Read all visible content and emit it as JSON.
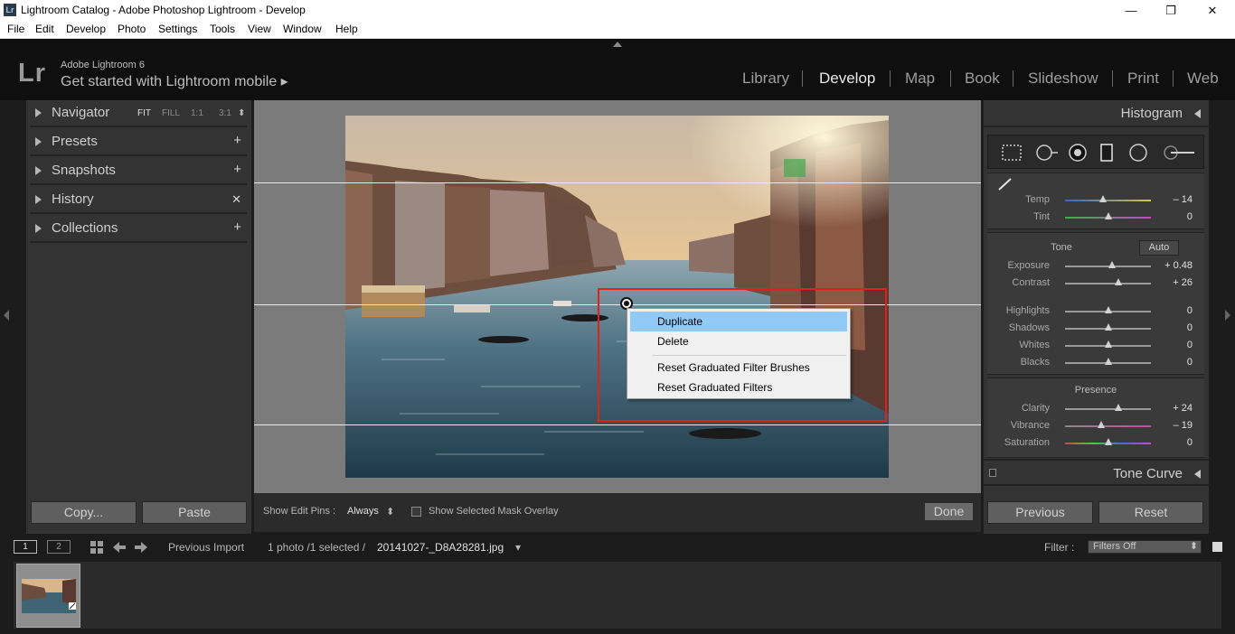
{
  "window": {
    "logo": "Lr",
    "title": "Lightroom Catalog - Adobe Photoshop Lightroom - Develop",
    "minimize": "—",
    "maximize": "❐",
    "close": "✕"
  },
  "menu": [
    "File",
    "Edit",
    "Develop",
    "Photo",
    "Settings",
    "Tools",
    "View",
    "Window",
    "Help"
  ],
  "identity": {
    "logo": "Lr",
    "product": "Adobe Lightroom 6",
    "mobile": "Get started with Lightroom mobile ▸"
  },
  "modules": {
    "items": [
      "Library",
      "Develop",
      "Map",
      "Book",
      "Slideshow",
      "Print",
      "Web"
    ],
    "active": "Develop"
  },
  "left_panel": {
    "navigator": {
      "label": "Navigator",
      "zoom": [
        "FIT",
        "FILL",
        "1:1",
        "3:1"
      ],
      "selected_zoom": "FIT",
      "menu_glyph": "⬍"
    },
    "presets": {
      "label": "Presets",
      "action": "+"
    },
    "snapshots": {
      "label": "Snapshots",
      "action": "+"
    },
    "history": {
      "label": "History",
      "action": "✕"
    },
    "collections": {
      "label": "Collections",
      "action": "+"
    },
    "copy_label": "Copy...",
    "paste_label": "Paste"
  },
  "context_menu": {
    "items": [
      "Duplicate",
      "Delete",
      "Reset Graduated Filter Brushes",
      "Reset Graduated Filters"
    ],
    "highlighted": "Duplicate"
  },
  "toolbar": {
    "show_edit_pins_label": "Show Edit Pins :",
    "show_edit_pins_value": "Always",
    "value_glyph": "⬍",
    "mask_overlay_label": "Show Selected Mask Overlay",
    "mask_overlay_checked": false,
    "done_label": "Done"
  },
  "right_panel": {
    "histogram_label": "Histogram",
    "tools": [
      "crop-overlay",
      "spot-removal",
      "red-eye",
      "graduated-filter",
      "radial-filter",
      "adjustment-brush"
    ],
    "wb_sliders": [
      {
        "name": "Temp",
        "value": "– 14",
        "position": 0.44
      },
      {
        "name": "Tint",
        "value": "0",
        "position": 0.5
      }
    ],
    "tone": {
      "title": "Tone",
      "auto_label": "Auto",
      "sliders": [
        {
          "name": "Exposure",
          "value": "+ 0.48",
          "position": 0.55
        },
        {
          "name": "Contrast",
          "value": "+ 26",
          "position": 0.62
        }
      ],
      "sliders2": [
        {
          "name": "Highlights",
          "value": "0",
          "position": 0.5
        },
        {
          "name": "Shadows",
          "value": "0",
          "position": 0.5
        },
        {
          "name": "Whites",
          "value": "0",
          "position": 0.5
        },
        {
          "name": "Blacks",
          "value": "0",
          "position": 0.5
        }
      ]
    },
    "presence": {
      "title": "Presence",
      "sliders": [
        {
          "name": "Clarity",
          "value": "+ 24",
          "position": 0.62
        },
        {
          "name": "Vibrance",
          "value": "– 19",
          "position": 0.42
        },
        {
          "name": "Saturation",
          "value": "0",
          "position": 0.5
        }
      ]
    },
    "tone_curve_label": "Tone Curve",
    "previous_label": "Previous",
    "reset_label": "Reset"
  },
  "filmstrip": {
    "monitor1": "1",
    "monitor2": "2",
    "source": "Previous Import",
    "count": "1 photo /1 selected /",
    "filename": "20141027-_D8A28281.jpg",
    "filename_glyph": "▾",
    "filter_label": "Filter :",
    "filter_value": "Filters Off",
    "filter_glyph": "⬍"
  },
  "colors": {
    "accent": "#91c9f7",
    "highlight_box": "#e0201c",
    "panel_bg": "#333333"
  }
}
